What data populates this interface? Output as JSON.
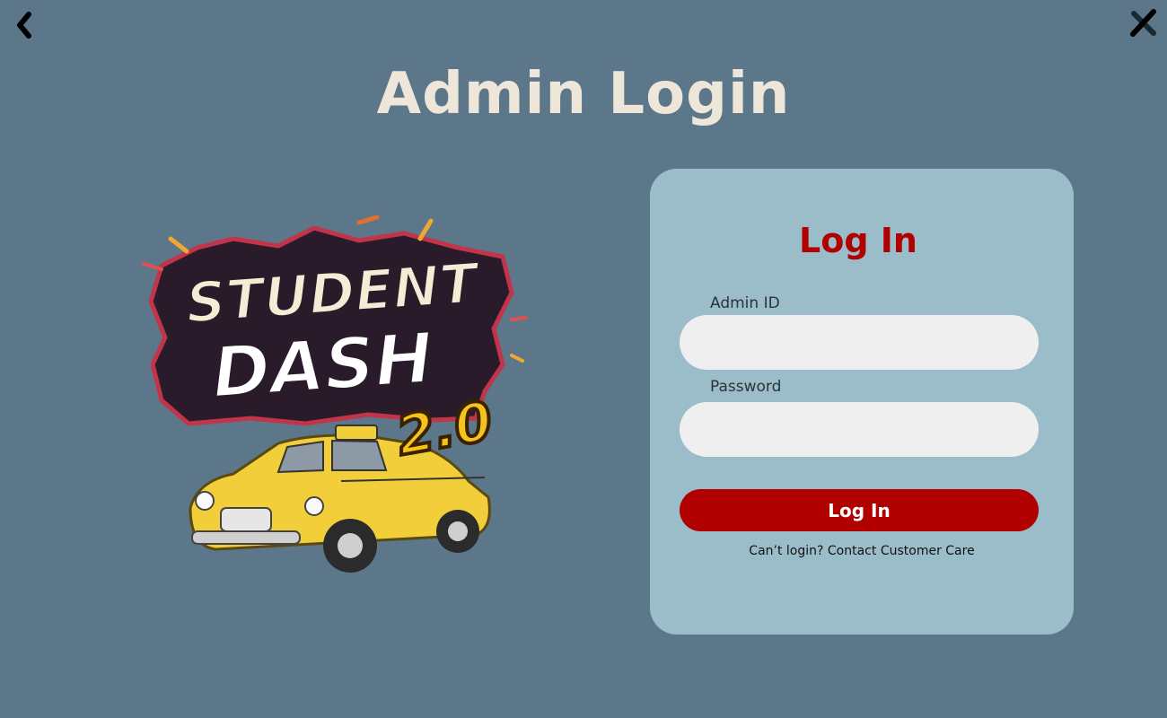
{
  "header": {
    "title": "Admin Login",
    "back_icon": "chevron-left-icon",
    "close_icon": "close-icon"
  },
  "logo": {
    "line1": "STUDENT",
    "line2": "DASH",
    "version": "2.0",
    "image": "yellow-taxi"
  },
  "login_form": {
    "title": "Log In",
    "admin_id": {
      "label": "Admin ID",
      "value": "",
      "placeholder": ""
    },
    "password": {
      "label": "Password",
      "value": "",
      "placeholder": ""
    },
    "submit_label": "Log In",
    "help_text": "Can’t login? Contact Customer Care"
  },
  "colors": {
    "background": "#5b7789",
    "title": "#efe6da",
    "panel": "#9bbdc9",
    "accent": "#b00000",
    "input": "#efefef"
  }
}
